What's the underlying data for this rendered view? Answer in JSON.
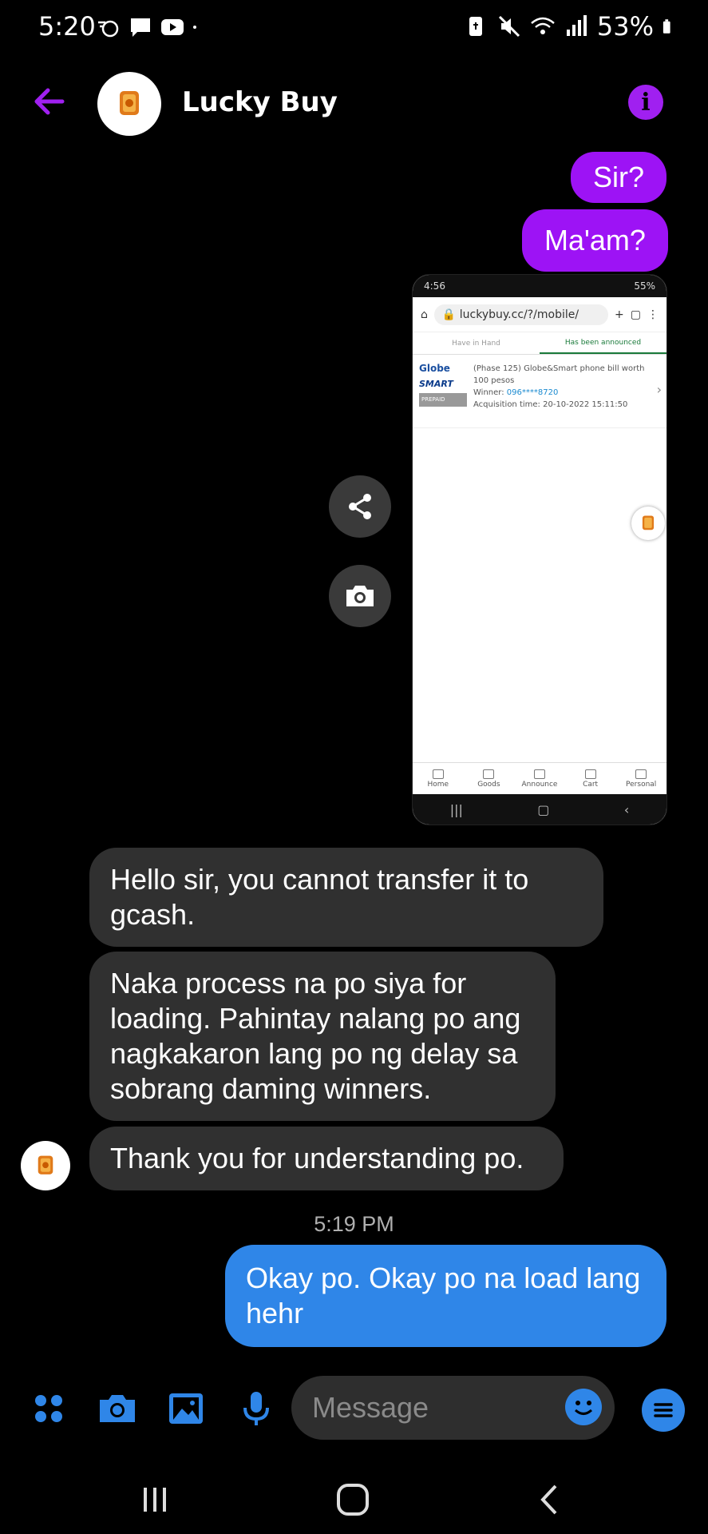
{
  "status_bar": {
    "time": "5:20",
    "battery": "53%",
    "left_icons": [
      "tracker-icon",
      "chat-bubble-icon",
      "youtube-icon",
      "dot-icon"
    ],
    "right_icons": [
      "battery-saver-icon",
      "mute-icon",
      "wifi-icon",
      "signal-icon",
      "battery-icon"
    ]
  },
  "header": {
    "title": "Lucky Buy",
    "back_icon": "arrow-left-icon",
    "info_icon": "info-icon",
    "info_symbol": "i"
  },
  "messages": {
    "out_sir": "Sir?",
    "out_maam": "Ma'am?",
    "in_1": "Hello sir, you cannot transfer it to gcash.",
    "in_2": "Naka process na po siya for loading. Pahintay nalang po ang nagkakaron lang po ng delay sa sobrang daming winners.",
    "in_3": "Thank you for understanding po.",
    "timestamp": "5:19 PM",
    "out_blue": "Okay po. Okay po na load lang hehr"
  },
  "shared_screenshot": {
    "status_time": "4:56",
    "status_battery": "55%",
    "url": "luckybuy.cc/?/mobile/",
    "tabs": [
      "Have in Hand",
      "Has been announced"
    ],
    "item": {
      "title": "(Phase 125) Globe&Smart phone bill worth 100 pesos",
      "winner_label": "Winner:",
      "winner_value": "096****8720",
      "acq_label": "Acquisition time:",
      "acq_value": "20-10-2022 15:11:50",
      "globe": "Globe",
      "smart": "SMART",
      "smart_sub": "PREPAID"
    },
    "nav": [
      "Home",
      "Goods",
      "Announce",
      "Cart",
      "Personal"
    ]
  },
  "composer": {
    "placeholder": "Message",
    "icons": [
      "apps-icon",
      "camera-icon",
      "gallery-icon",
      "microphone-icon",
      "emoji-icon",
      "menu-icon"
    ]
  },
  "colors": {
    "purple": "#9d13f5",
    "blue": "#2f86e8",
    "incoming": "#303030"
  }
}
